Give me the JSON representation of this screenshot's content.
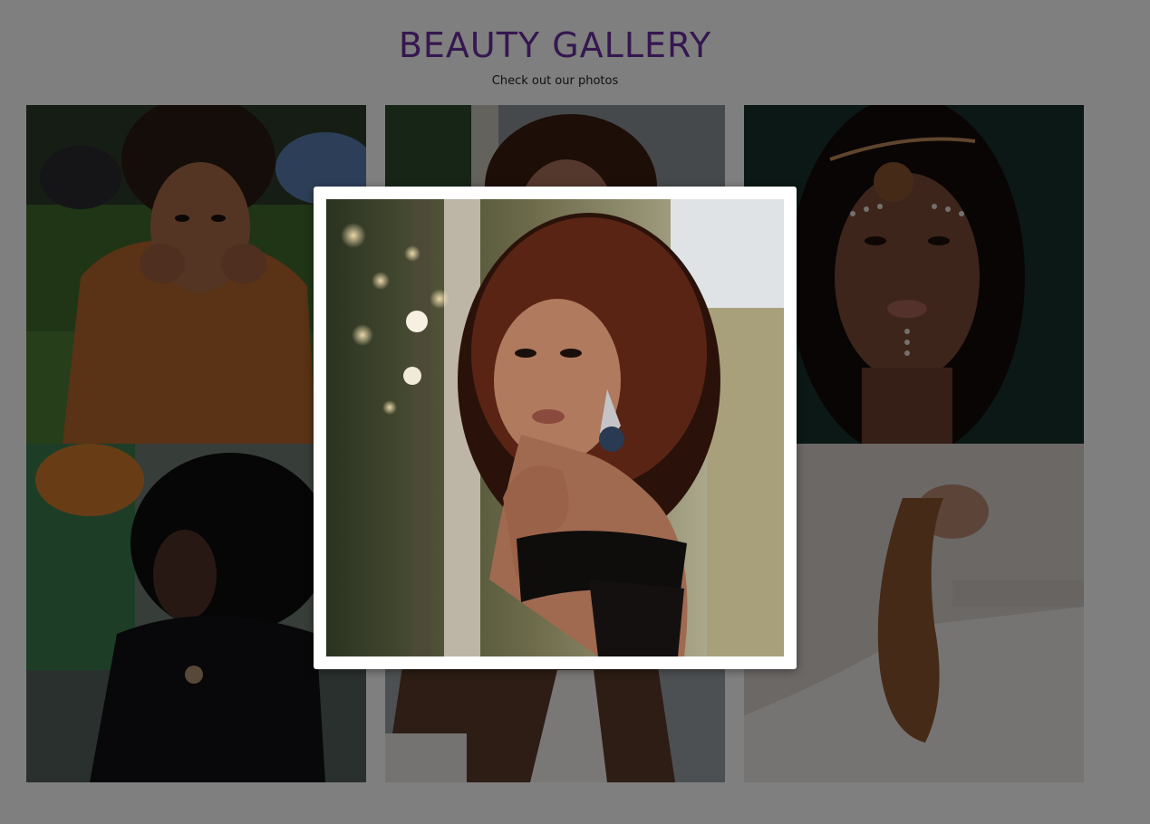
{
  "gallery": {
    "title": "BEAUTY GALLERY",
    "subtitle": "Check out our photos",
    "title_color": "#6a2fa0",
    "photos": [
      "photo-woman-lying-on-grass",
      "photo-woman-curly-hair-forest",
      "photo-woman-face-paint-headband",
      "photo-woman-black-top-pendant",
      "photo-woman-white-top",
      "photo-woman-hair-over-bathtub"
    ]
  },
  "lightbox": {
    "open": true,
    "photo": "photo-woman-curly-hair-forest",
    "overlay_color": "rgba(0,0,0,0.5)"
  }
}
